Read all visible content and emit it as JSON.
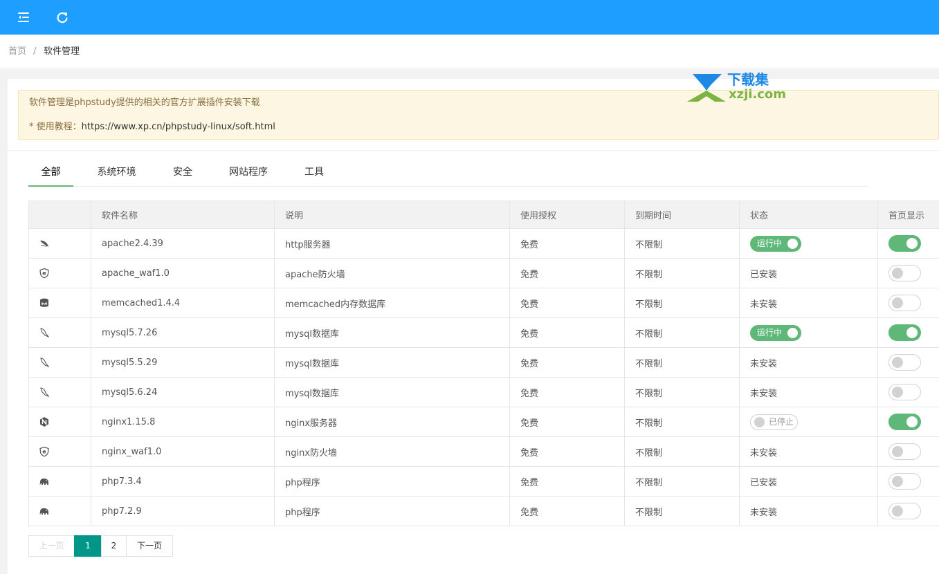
{
  "breadcrumb": {
    "home": "首页",
    "separator": "/",
    "current": "软件管理"
  },
  "notice": {
    "line1": "软件管理是phpstudy提供的相关的官方扩展插件安装下载",
    "line2_prefix": "* 使用教程：",
    "line2_url": "https://www.xp.cn/phpstudy-linux/soft.html"
  },
  "tabs": [
    {
      "label": "全部",
      "active": true
    },
    {
      "label": "系统环境",
      "active": false
    },
    {
      "label": "安全",
      "active": false
    },
    {
      "label": "网站程序",
      "active": false
    },
    {
      "label": "工具",
      "active": false
    }
  ],
  "table": {
    "headers": [
      "",
      "软件名称",
      "说明",
      "使用授权",
      "到期时间",
      "状态",
      "首页显示"
    ],
    "rows": [
      {
        "icon": "apache-feather-icon",
        "name": "apache2.4.39",
        "desc": "http服务器",
        "license": "免费",
        "expiry": "不限制",
        "status_type": "switch-on",
        "status": "运行中",
        "home_display": true
      },
      {
        "icon": "waf-shield-icon",
        "name": "apache_waf1.0",
        "desc": "apache防火墙",
        "license": "免费",
        "expiry": "不限制",
        "status_type": "text",
        "status": "已安装",
        "home_display": false
      },
      {
        "icon": "memcached-icon",
        "name": "memcached1.4.4",
        "desc": "memcached内存数据库",
        "license": "免费",
        "expiry": "不限制",
        "status_type": "text",
        "status": "未安装",
        "home_display": false
      },
      {
        "icon": "mysql-dolphin-icon",
        "name": "mysql5.7.26",
        "desc": "mysql数据库",
        "license": "免费",
        "expiry": "不限制",
        "status_type": "switch-on",
        "status": "运行中",
        "home_display": true
      },
      {
        "icon": "mysql-dolphin-icon",
        "name": "mysql5.5.29",
        "desc": "mysql数据库",
        "license": "免费",
        "expiry": "不限制",
        "status_type": "text",
        "status": "未安装",
        "home_display": false
      },
      {
        "icon": "mysql-dolphin-icon",
        "name": "mysql5.6.24",
        "desc": "mysql数据库",
        "license": "免费",
        "expiry": "不限制",
        "status_type": "text",
        "status": "未安装",
        "home_display": false
      },
      {
        "icon": "nginx-hexagon-icon",
        "name": "nginx1.15.8",
        "desc": "nginx服务器",
        "license": "免费",
        "expiry": "不限制",
        "status_type": "switch-off",
        "status": "已停止",
        "home_display": true
      },
      {
        "icon": "waf-shield-icon",
        "name": "nginx_waf1.0",
        "desc": "nginx防火墙",
        "license": "免费",
        "expiry": "不限制",
        "status_type": "text",
        "status": "未安装",
        "home_display": false
      },
      {
        "icon": "php-elephant-icon",
        "name": "php7.3.4",
        "desc": "php程序",
        "license": "免费",
        "expiry": "不限制",
        "status_type": "text",
        "status": "已安装",
        "home_display": false
      },
      {
        "icon": "php-elephant-icon",
        "name": "php7.2.9",
        "desc": "php程序",
        "license": "免费",
        "expiry": "不限制",
        "status_type": "text",
        "status": "未安装",
        "home_display": false
      }
    ]
  },
  "pagination": {
    "prev": "上一页",
    "pages": [
      "1",
      "2"
    ],
    "current": "1",
    "next": "下一页"
  },
  "watermark": {
    "line1": "下载集",
    "line2": "xzji.com"
  },
  "colors": {
    "topbar": "#1e9fff",
    "switch_on": "#5fb878",
    "page_current": "#009688"
  }
}
